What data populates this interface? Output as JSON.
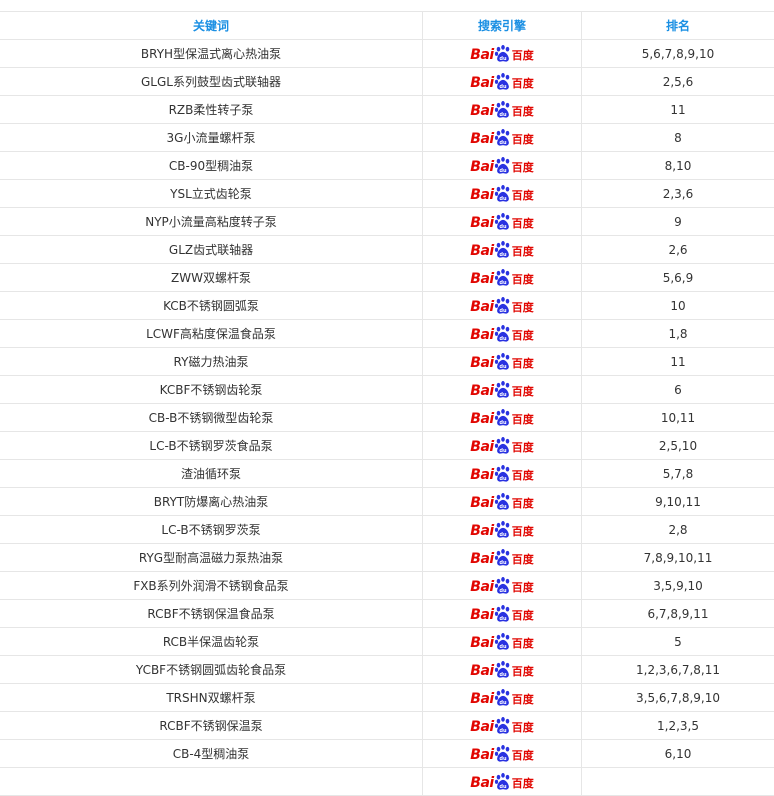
{
  "table": {
    "headers": {
      "keyword": "关键词",
      "engine": "搜索引擎",
      "rank": "排名"
    },
    "engine_logo": {
      "bai": "Bai",
      "du": "百度",
      "icon": "baidu-paw-icon",
      "color": "#e10601"
    },
    "rows": [
      {
        "keyword": "BRYH型保温式离心热油泵",
        "rank": "5,6,7,8,9,10"
      },
      {
        "keyword": "GLGL系列鼓型齿式联轴器",
        "rank": "2,5,6"
      },
      {
        "keyword": "RZB柔性转子泵",
        "rank": "11"
      },
      {
        "keyword": "3G小流量螺杆泵",
        "rank": "8"
      },
      {
        "keyword": "CB-90型稠油泵",
        "rank": "8,10"
      },
      {
        "keyword": "YSL立式齿轮泵",
        "rank": "2,3,6"
      },
      {
        "keyword": "NYP小流量高粘度转子泵",
        "rank": "9"
      },
      {
        "keyword": "GLZ齿式联轴器",
        "rank": "2,6"
      },
      {
        "keyword": "ZWW双螺杆泵",
        "rank": "5,6,9"
      },
      {
        "keyword": "KCB不锈钢圆弧泵",
        "rank": "10"
      },
      {
        "keyword": "LCWF高粘度保温食品泵",
        "rank": "1,8"
      },
      {
        "keyword": "RY磁力热油泵",
        "rank": "11"
      },
      {
        "keyword": "KCBF不锈钢齿轮泵",
        "rank": "6"
      },
      {
        "keyword": "CB-B不锈钢微型齿轮泵",
        "rank": "10,11"
      },
      {
        "keyword": "LC-B不锈钢罗茨食品泵",
        "rank": "2,5,10"
      },
      {
        "keyword": "渣油循环泵",
        "rank": "5,7,8"
      },
      {
        "keyword": "BRYT防爆离心热油泵",
        "rank": "9,10,11"
      },
      {
        "keyword": "LC-B不锈钢罗茨泵",
        "rank": "2,8"
      },
      {
        "keyword": "RYG型耐高温磁力泵热油泵",
        "rank": "7,8,9,10,11"
      },
      {
        "keyword": "FXB系列外润滑不锈钢食品泵",
        "rank": "3,5,9,10"
      },
      {
        "keyword": "RCBF不锈钢保温食品泵",
        "rank": "6,7,8,9,11"
      },
      {
        "keyword": "RCB半保温齿轮泵",
        "rank": "5"
      },
      {
        "keyword": "YCBF不锈钢圆弧齿轮食品泵",
        "rank": "1,2,3,6,7,8,11"
      },
      {
        "keyword": "TRSHN双螺杆泵",
        "rank": "3,5,6,7,8,9,10"
      },
      {
        "keyword": "RCBF不锈钢保温泵",
        "rank": "1,2,3,5"
      },
      {
        "keyword": "CB-4型稠油泵",
        "rank": "6,10"
      },
      {
        "keyword": "",
        "rank": ""
      }
    ]
  }
}
